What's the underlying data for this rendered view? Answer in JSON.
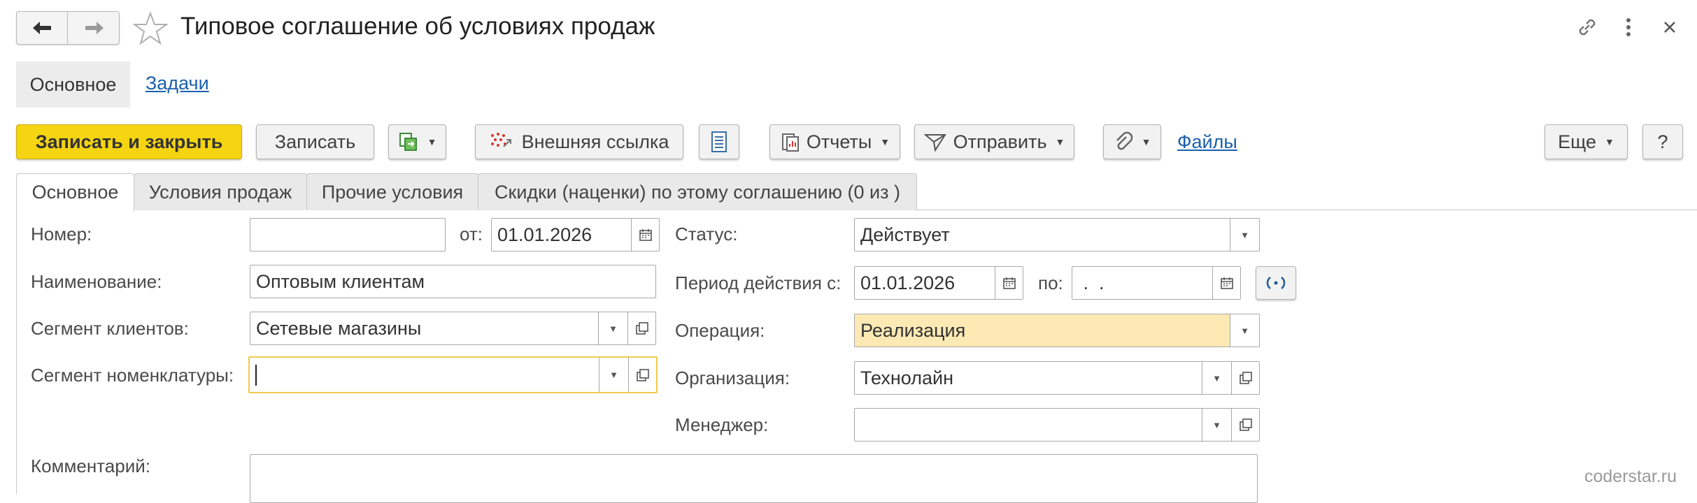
{
  "window": {
    "title": "Типовое соглашение об условиях продаж"
  },
  "nav_tabs": {
    "main": "Основное",
    "tasks": "Задачи"
  },
  "toolbar": {
    "save_close": "Записать и закрыть",
    "save": "Записать",
    "external_link": "Внешняя ссылка",
    "reports": "Отчеты",
    "send": "Отправить",
    "files": "Файлы",
    "more": "Еще",
    "help": "?"
  },
  "form_tabs": [
    "Основное",
    "Условия продаж",
    "Прочие условия",
    "Скидки (наценки) по этому соглашению (0 из )"
  ],
  "fields": {
    "number_label": "Номер:",
    "number_value": "",
    "from_label": "от:",
    "from_value": "01.01.2026",
    "name_label": "Наименование:",
    "name_value": "Оптовым клиентам",
    "client_segment_label": "Сегмент клиентов:",
    "client_segment_value": "Сетевые магазины",
    "nomenclature_segment_label": "Сегмент номенклатуры:",
    "nomenclature_segment_value": "",
    "comment_label": "Комментарий:",
    "status_label": "Статус:",
    "status_value": "Действует",
    "period_label": "Период действия с:",
    "period_from": "01.01.2026",
    "period_to_label": "по:",
    "period_to": " .  .",
    "operation_label": "Операция:",
    "operation_value": "Реализация",
    "organization_label": "Организация:",
    "organization_value": "Технолайн",
    "manager_label": "Менеджер:",
    "manager_value": ""
  },
  "watermark": "coderstar.ru",
  "colors": {
    "primary_button": "#f5d411",
    "highlight_field": "#fce9b4",
    "focus_border": "#f2c94c",
    "link": "#1b5fae"
  }
}
